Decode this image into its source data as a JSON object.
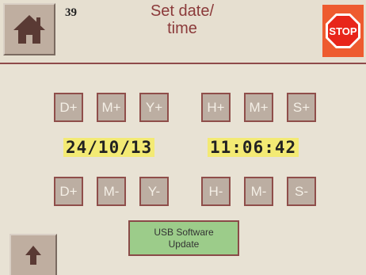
{
  "header": {
    "screen_number": "39",
    "title_line1": "Set date/",
    "title_line2": "time",
    "stop_label": "STOP"
  },
  "date_controls": {
    "day_plus": "D+",
    "month_plus": "M+",
    "year_plus": "Y+",
    "day_minus": "D+",
    "month_minus": "M-",
    "year_minus": "Y-"
  },
  "time_controls": {
    "hour_plus": "H+",
    "minute_plus": "M+",
    "second_plus": "S+",
    "hour_minus": "H-",
    "minute_minus": "M-",
    "second_minus": "S-"
  },
  "readouts": {
    "date": "24/10/13",
    "time": "11:06:42"
  },
  "usb_button": {
    "line1": "USB Software",
    "line2": "Update"
  },
  "colors": {
    "background": "#e8e2d4",
    "title": "#8b3a3a",
    "stop": "#ee5b2f",
    "readout_highlight": "#f3ea74",
    "usb_button": "#9ccc8a",
    "button_face": "#bcaea2"
  }
}
